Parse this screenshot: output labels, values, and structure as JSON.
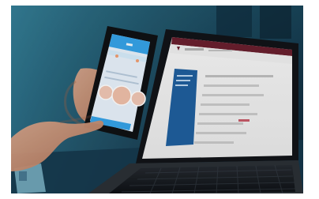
{
  "scene": {
    "subject": "smartphone-with-face-app-beside-laptop-web-form",
    "phone": {
      "icons": [
        "face-thumbnail-icon",
        "face-thumbnail-icon",
        "face-thumbnail-icon"
      ]
    },
    "laptop": {
      "icons": [
        "logo-mark-icon"
      ]
    },
    "colors": {
      "background": "#1e5266",
      "phone_app_header": "#36a3e8",
      "phone_app_body": "#eef5fb",
      "laptop_sidebar": "#1f5f9e",
      "laptop_topbar": "#6a1f2e",
      "laptop_page": "#f3f3f3"
    }
  }
}
